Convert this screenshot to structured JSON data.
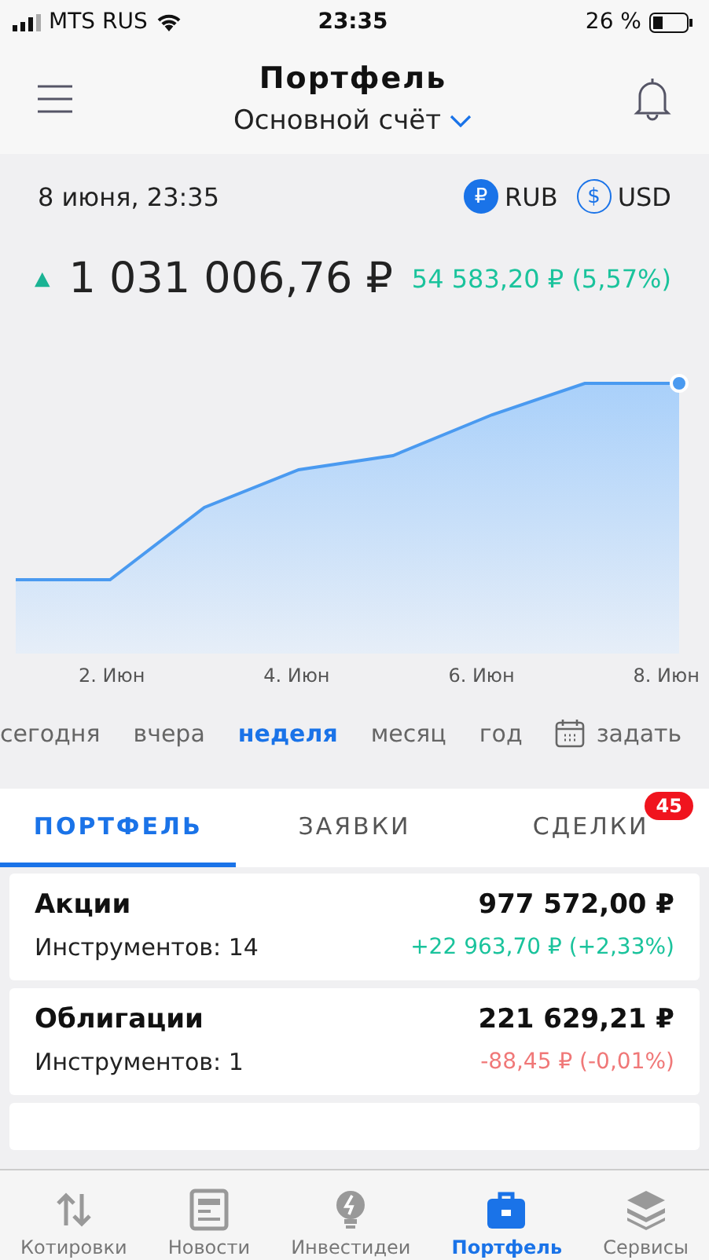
{
  "status_bar": {
    "carrier": "MTS RUS",
    "time": "23:35",
    "battery": "26 %"
  },
  "header": {
    "title": "Портфель",
    "account": "Основной счёт"
  },
  "summary": {
    "date": "8 июня, 23:35",
    "currencies": [
      {
        "label": "RUB",
        "symbol": "₽",
        "selected": true
      },
      {
        "label": "USD",
        "symbol": "$",
        "selected": false
      }
    ],
    "total": "1 031 006,76 ₽",
    "change": "54 583,20 ₽ (5,57%)"
  },
  "chart": {
    "x_labels": [
      "2. Июн",
      "4. Июн",
      "6. Июн",
      "8. Июн"
    ]
  },
  "periods": [
    {
      "label": "сегодня",
      "kind": "text",
      "selected": false
    },
    {
      "label": "вчера",
      "kind": "text",
      "selected": false
    },
    {
      "label": "неделя",
      "kind": "text",
      "selected": true
    },
    {
      "label": "месяц",
      "kind": "text",
      "selected": false
    },
    {
      "label": "год",
      "kind": "text",
      "selected": false
    },
    {
      "label": "задать",
      "kind": "calendar",
      "selected": false
    }
  ],
  "tabs": [
    {
      "label": "ПОРТФЕЛЬ",
      "selected": true
    },
    {
      "label": "ЗАЯВКИ",
      "selected": false
    },
    {
      "label": "СДЕЛКИ",
      "selected": false,
      "badge": "45"
    }
  ],
  "groups": [
    {
      "name": "Акции",
      "count": "Инструментов: 14",
      "value": "977 572,00 ₽",
      "change": "+22 963,70 ₽ (+2,33%)",
      "color": "#1ac39c"
    },
    {
      "name": "Облигации",
      "count": "Инструментов: 1",
      "value": "221 629,21 ₽",
      "change": "-88,45 ₽ (-0,01%)",
      "color": "#f07878"
    }
  ],
  "nav": [
    {
      "label": "Котировки",
      "selected": false
    },
    {
      "label": "Новости",
      "selected": false
    },
    {
      "label": "Инвестидеи",
      "selected": false
    },
    {
      "label": "Портфель",
      "selected": true
    },
    {
      "label": "Сервисы",
      "selected": false
    }
  ]
}
